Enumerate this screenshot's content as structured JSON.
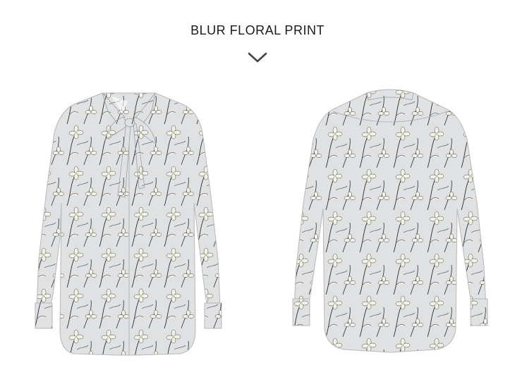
{
  "heading": {
    "title": "BLUR FLORAL PRINT"
  },
  "icons": {
    "scroll_hint": "chevron-down-icon"
  },
  "products": [
    {
      "view": "front",
      "image": "floral-blouse-front"
    },
    {
      "view": "back",
      "image": "floral-blouse-back"
    }
  ],
  "colors": {
    "fabric": "#dfe1e3",
    "print_line": "#2c2c2c",
    "flower": "#f3f2e6",
    "text": "#1a1a1a"
  }
}
